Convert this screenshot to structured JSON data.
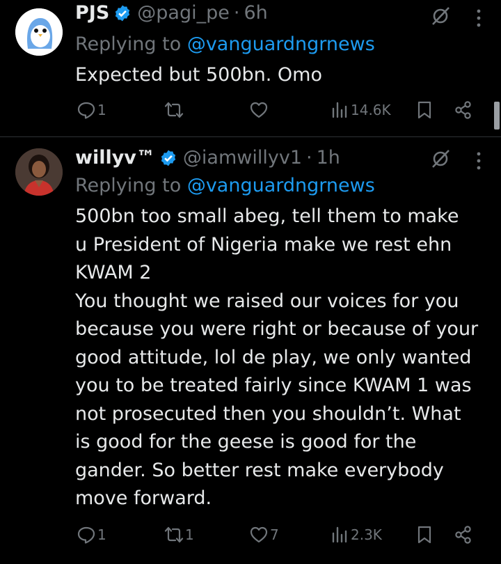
{
  "tweets": [
    {
      "name": "PJS",
      "handle": "@pagi_pe",
      "dot": "·",
      "time": "6h",
      "reply_prefix": "Replying to ",
      "reply_mention": "@vanguardngrnews",
      "text": "Expected but 500bn. Omo",
      "replies": "1",
      "retweets": "",
      "likes": "",
      "views": "14.6K",
      "avatar_icon": "penguin-avatar"
    },
    {
      "name": "willyv™",
      "handle": "@iamwillyv1",
      "dot": "·",
      "time": "1h",
      "reply_prefix": "Replying to ",
      "reply_mention": "@vanguardngrnews",
      "text": "500bn too small abeg, tell them to make\nu President of Nigeria make we rest ehn\nKWAM 2\nYou thought we raised our voices for you\nbecause you were right or because of your\ngood attitude, lol de play, we only wanted\nyou to be treated fairly since KWAM 1 was\nnot prosecuted then you shouldn’t. What\nis good for the geese is good for the\ngander. So better rest make everybody\nmove forward.",
      "replies": "1",
      "retweets": "1",
      "likes": "7",
      "views": "2.3K",
      "avatar_icon": "profile-photo-avatar"
    }
  ],
  "colors": {
    "background": "#000000",
    "text": "#e7e9ea",
    "muted": "#71767b",
    "link": "#1d9bf0",
    "verified": "#1d9bf0"
  }
}
